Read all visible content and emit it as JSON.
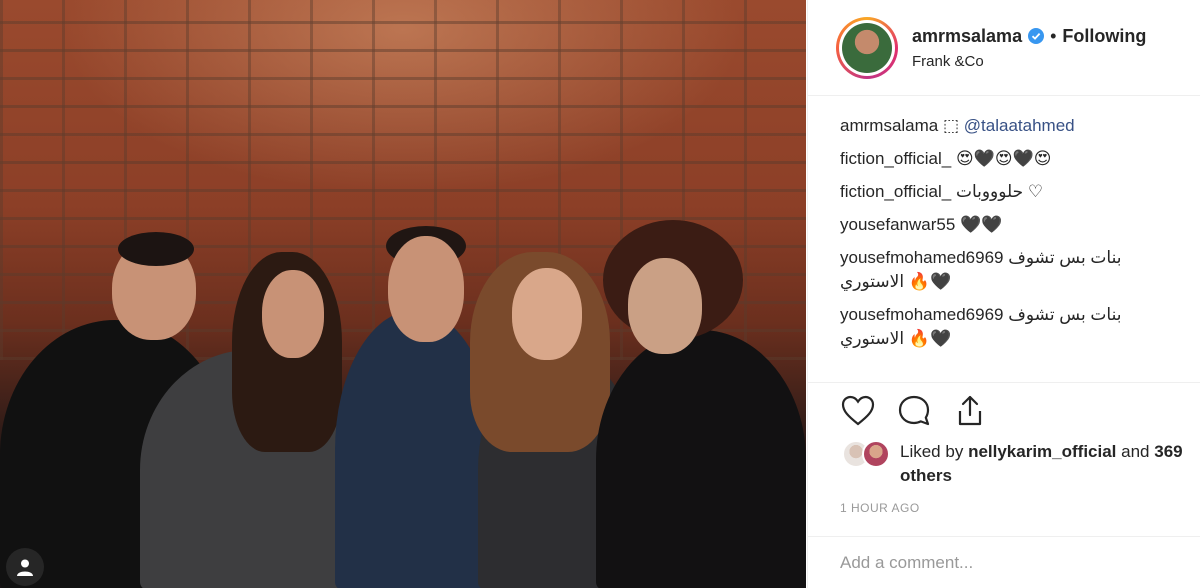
{
  "post": {
    "username": "amrmsalama",
    "follow_state": "Following",
    "separator": "•",
    "location": "Frank &Co"
  },
  "comments": [
    {
      "user": "amrmsalama",
      "text": "⬚",
      "mention": "@talaatahmed"
    },
    {
      "user": "fiction_official_",
      "text": "😍🖤😍🖤😍"
    },
    {
      "user": "fiction_official_",
      "text": "حلوووبات ♡"
    },
    {
      "user": "yousefanwar55",
      "text": "🖤🖤"
    },
    {
      "user": "yousefmohamed6969",
      "text": "بنات بس تشوف الاستوري 🔥🖤"
    },
    {
      "user": "yousefmohamed6969",
      "text": "بنات بس تشوف الاستوري 🔥🖤"
    }
  ],
  "likes": {
    "prefix": "Liked by",
    "liker": "nellykarim_official",
    "suffix": "and",
    "others": "369 others"
  },
  "timestamp": "1 HOUR AGO",
  "add_comment_placeholder": "Add a comment...",
  "icons": [
    "heart-icon",
    "comment-icon",
    "share-icon",
    "verified-badge-icon",
    "user-tag-icon"
  ],
  "colors": {
    "link": "#385185",
    "verified": "#3897f0",
    "muted": "#999999",
    "text": "#262626"
  }
}
